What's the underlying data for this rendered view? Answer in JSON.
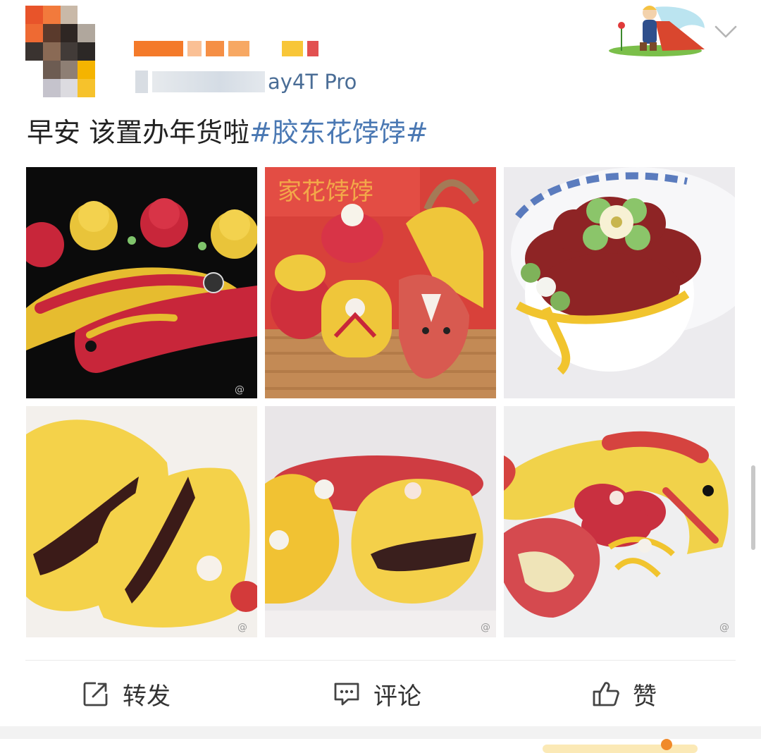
{
  "post": {
    "source_suffix": "ay4T Pro",
    "text_plain": "早安 该置办年货啦",
    "hashtag": "#胶东花饽饽#"
  },
  "images": [
    {
      "name": "photo-1",
      "theme": "dark"
    },
    {
      "name": "photo-2",
      "theme": "red"
    },
    {
      "name": "photo-3",
      "theme": "plate"
    },
    {
      "name": "photo-4",
      "theme": "yellow-cut"
    },
    {
      "name": "photo-5",
      "theme": "yellow-bowl"
    },
    {
      "name": "photo-6",
      "theme": "koi"
    }
  ],
  "actions": {
    "repost_label": "转发",
    "comment_label": "评论",
    "like_label": "赞"
  },
  "icons": {
    "repost": "share-icon",
    "comment": "comment-icon",
    "like": "thumbs-up-icon",
    "more": "chevron-down-icon"
  },
  "colors": {
    "text": "#222222",
    "link": "#4a78b3",
    "source": "#4a6d96",
    "divider": "#ebebeb"
  }
}
